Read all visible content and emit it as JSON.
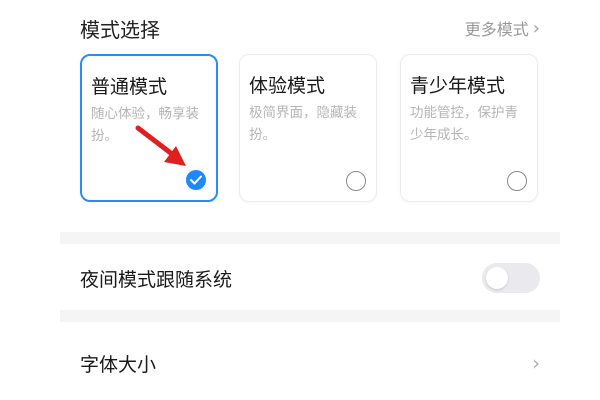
{
  "mode_section": {
    "title": "模式选择",
    "more_label": "更多模式",
    "more_chevron": "›",
    "cards": [
      {
        "title": "普通模式",
        "desc": "随心体验，畅享装扮。",
        "selected": true
      },
      {
        "title": "体验模式",
        "desc": "极简界面，隐藏装扮。",
        "selected": false
      },
      {
        "title": "青少年模式",
        "desc": "功能管控，保护青少年成长。",
        "selected": false
      }
    ]
  },
  "settings": {
    "night_mode_label": "夜间模式跟随系统",
    "night_mode_on": false,
    "font_size_label": "字体大小",
    "font_size_chevron": "›"
  },
  "colors": {
    "accent": "#1e88ff",
    "arrow": "#e02020",
    "divider": "#f5f5f5"
  },
  "icons": {
    "more_chevron": "chevron-right-icon",
    "check": "check-icon",
    "annotation": "red-arrow-icon"
  }
}
